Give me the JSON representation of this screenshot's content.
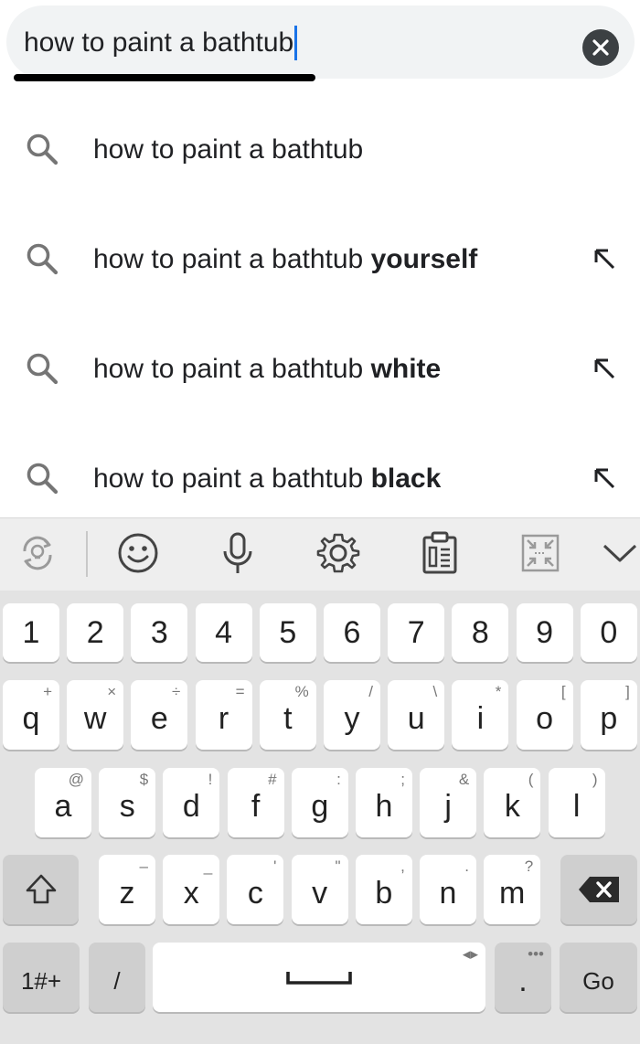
{
  "search": {
    "query": "how to paint a bathtub",
    "clear_icon": "close-icon"
  },
  "suggestions": [
    {
      "base": "how to paint a bathtub",
      "bold": "",
      "icon": "search-icon",
      "fill_arrow": false
    },
    {
      "base": "how to paint a bathtub ",
      "bold": "yourself",
      "icon": "search-icon",
      "fill_arrow": true
    },
    {
      "base": "how to paint a bathtub ",
      "bold": "white",
      "icon": "search-icon",
      "fill_arrow": true
    },
    {
      "base": "how to paint a bathtub ",
      "bold": "black",
      "icon": "search-icon",
      "fill_arrow": true
    }
  ],
  "keyboard": {
    "toolbar_icons": [
      "translate-icon",
      "emoji-icon",
      "microphone-icon",
      "gear-icon",
      "clipboard-icon",
      "resize-icon",
      "chevron-down-icon"
    ],
    "number_row": [
      "1",
      "2",
      "3",
      "4",
      "5",
      "6",
      "7",
      "8",
      "9",
      "0"
    ],
    "row1": [
      {
        "k": "q",
        "a": "+"
      },
      {
        "k": "w",
        "a": "×"
      },
      {
        "k": "e",
        "a": "÷"
      },
      {
        "k": "r",
        "a": "="
      },
      {
        "k": "t",
        "a": "%"
      },
      {
        "k": "y",
        "a": "/"
      },
      {
        "k": "u",
        "a": "\\"
      },
      {
        "k": "i",
        "a": "*"
      },
      {
        "k": "o",
        "a": "["
      },
      {
        "k": "p",
        "a": "]"
      }
    ],
    "row2": [
      {
        "k": "a",
        "a": "@"
      },
      {
        "k": "s",
        "a": "$"
      },
      {
        "k": "d",
        "a": "!"
      },
      {
        "k": "f",
        "a": "#"
      },
      {
        "k": "g",
        "a": ":"
      },
      {
        "k": "h",
        "a": ";"
      },
      {
        "k": "j",
        "a": "&"
      },
      {
        "k": "k",
        "a": "("
      },
      {
        "k": "l",
        "a": ")"
      }
    ],
    "row3": [
      {
        "k": "z",
        "a": "–"
      },
      {
        "k": "x",
        "a": "_"
      },
      {
        "k": "c",
        "a": "'"
      },
      {
        "k": "v",
        "a": "\""
      },
      {
        "k": "b",
        "a": ","
      },
      {
        "k": "n",
        "a": "."
      },
      {
        "k": "m",
        "a": "?"
      }
    ],
    "symbols_label": "1#+",
    "slash_label": "/",
    "period_label": ".",
    "period_alt": "•••",
    "space_alt": "◂▸",
    "go_label": "Go"
  }
}
